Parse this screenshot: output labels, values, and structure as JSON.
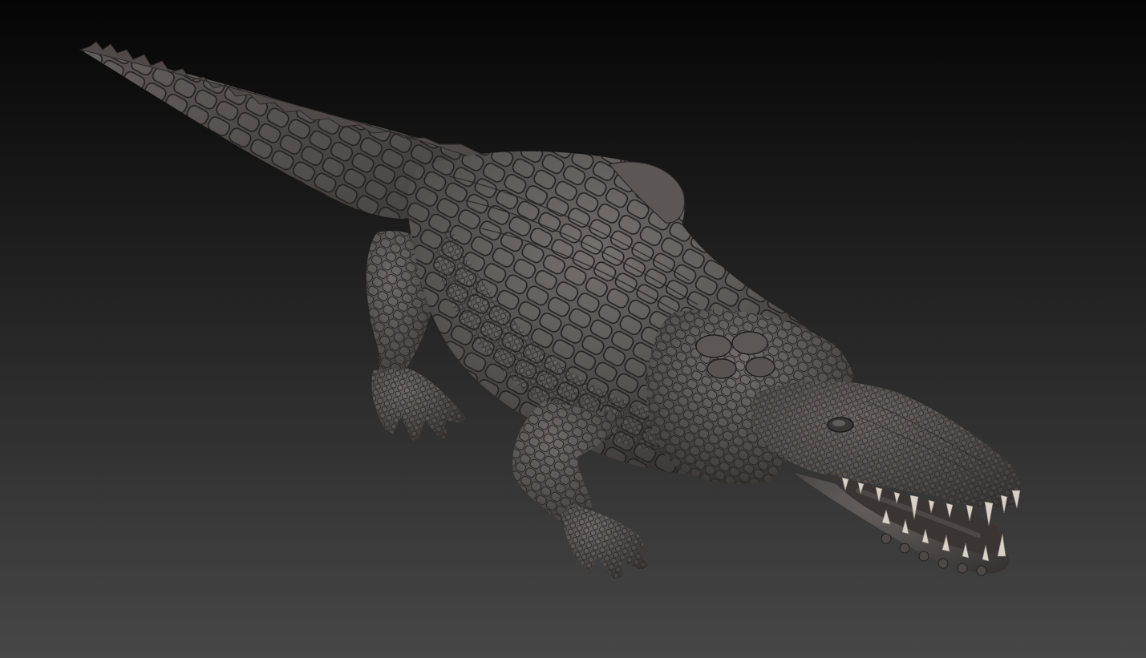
{
  "scene": {
    "subject": "crocodile-sculpt",
    "background_top": "#050505",
    "background_bottom": "#474747",
    "skin_light": "#6a6563",
    "skin_mid": "#4b4745",
    "skin_dark": "#2a2726",
    "scale_line": "#231f1e",
    "tooth_color": "#d9d2c8",
    "mouth_inner": "#3a3533"
  }
}
